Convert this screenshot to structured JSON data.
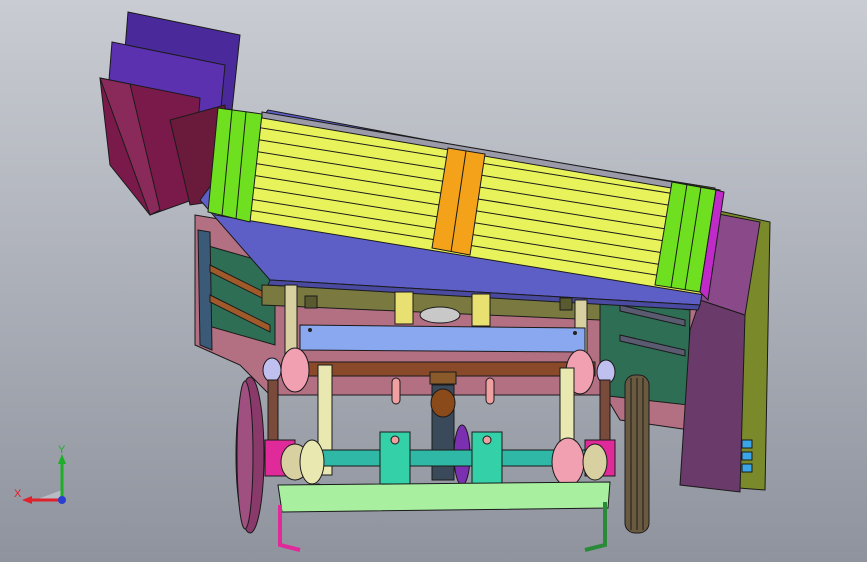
{
  "triad": {
    "x_label": "X",
    "y_label": "Y",
    "x_color": "#e0202a",
    "y_color": "#1fae2a",
    "z_color": "#2a3fd0"
  },
  "colors": {
    "background_top": "#c9ccd2",
    "background_bottom": "#8f939d",
    "screen_yellow": "#e8f25a",
    "band_green": "#6ee01f",
    "band_orange": "#f4a21a",
    "housing_blue": "#5a5fc8",
    "hopper_purple": "#5a2fa0",
    "hopper_maroon": "#7a1a4a",
    "frame_pink": "#b06a7c",
    "shaft_teal": "#2fb8a6",
    "pulley_grey": "#7a6a50"
  }
}
